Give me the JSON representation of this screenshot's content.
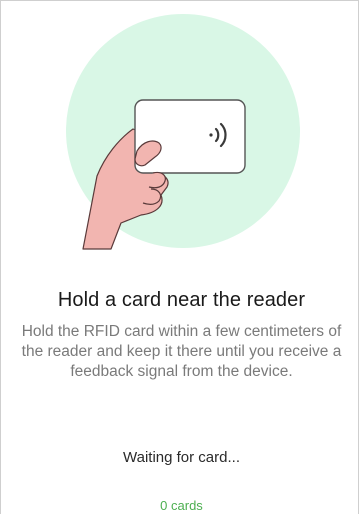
{
  "illustration": {
    "circle_color": "#d9f7e6",
    "card_icon": "nfc-contactless-icon",
    "hand_color": "#f2b5b0",
    "hand_stroke": "#5a3a3a"
  },
  "content": {
    "title": "Hold a card near the reader",
    "description": "Hold the RFID card within a few centimeters of the reader and keep it there until you receive a feedback signal from the device.",
    "status": "Waiting for card...",
    "count": "0 cards",
    "count_color": "#4caf50"
  }
}
